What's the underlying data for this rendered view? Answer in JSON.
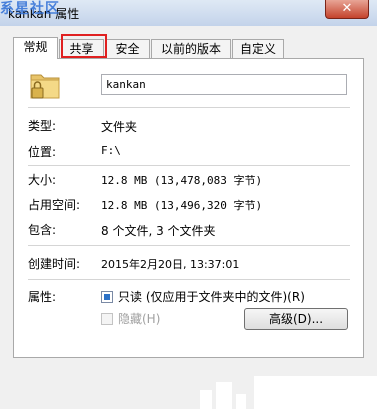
{
  "watermark": "系星社区",
  "window": {
    "title": "kankan 属性",
    "close_label": "✕"
  },
  "tabs": [
    {
      "label": "常规",
      "active": true
    },
    {
      "label": "共享",
      "active": false,
      "highlighted": true
    },
    {
      "label": "安全",
      "active": false
    },
    {
      "label": "以前的版本",
      "active": false
    },
    {
      "label": "自定义",
      "active": false
    }
  ],
  "general": {
    "folder_name": "kankan",
    "type_label": "类型:",
    "type_value": "文件夹",
    "location_label": "位置:",
    "location_value": "F:\\",
    "size_label": "大小:",
    "size_value": "12.8 MB (13,478,083 字节)",
    "size_on_disk_label": "占用空间:",
    "size_on_disk_value": "12.8 MB (13,496,320 字节)",
    "contains_label": "包含:",
    "contains_value": "8 个文件, 3 个文件夹",
    "created_label": "创建时间:",
    "created_value": "2015年2月20日, 13:37:01",
    "attributes_label": "属性:",
    "readonly_label": "只读 (仅应用于文件夹中的文件)(R)",
    "readonly_checked": true,
    "hidden_label": "隐藏(H)",
    "hidden_checked": false,
    "advanced_button": "高级(D)..."
  },
  "colors": {
    "highlight_border": "#e02020",
    "checkbox_fill": "#2b71c6"
  }
}
